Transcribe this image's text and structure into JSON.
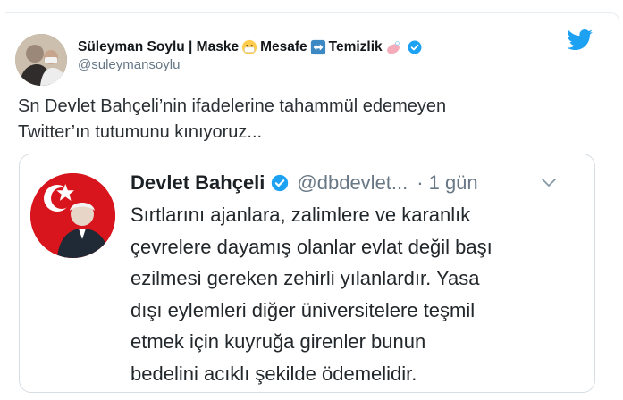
{
  "tweet": {
    "author_name_parts": [
      "Süleyman Soylu | Maske",
      "Mesafe",
      "Temizlik"
    ],
    "author_emojis": [
      "face-with-mask-emoji",
      "left-right-arrow-emoji",
      "soap-emoji"
    ],
    "handle": "@suleymansoylu",
    "verified": true,
    "text_lines": [
      "Sn Devlet Bahçeli’nin ifadelerine tahammül edemeyen",
      "Twitter’ın tutumunu kınıyoruz..."
    ]
  },
  "quoted_tweet": {
    "author_name": "Devlet Bahçeli",
    "handle": "@dbdevlet...",
    "separator": "·",
    "time": "1 gün",
    "verified": true,
    "text_lines": [
      "Sırtlarını ajanlara, zalimlere ve karanlık",
      "çevrelere dayamış olanlar evlat değil başı",
      "ezilmesi gereken zehirli yılanlardır. Yasa",
      "dışı eylemleri diğer üniversitelere teşmil",
      "etmek için kuyruğa girenler bunun",
      "bedelini acıklı şekilde ödemelidir."
    ]
  },
  "icons": {
    "twitter_logo": "twitter-bird-icon",
    "verified_badge": "verified-badge-icon",
    "more": "chevron-down-icon"
  },
  "colors": {
    "twitter_blue": "#1da1f2",
    "text": "#14171a",
    "secondary_text": "#657786",
    "border": "#e6ecf0",
    "flag_red": "#d8151c"
  }
}
